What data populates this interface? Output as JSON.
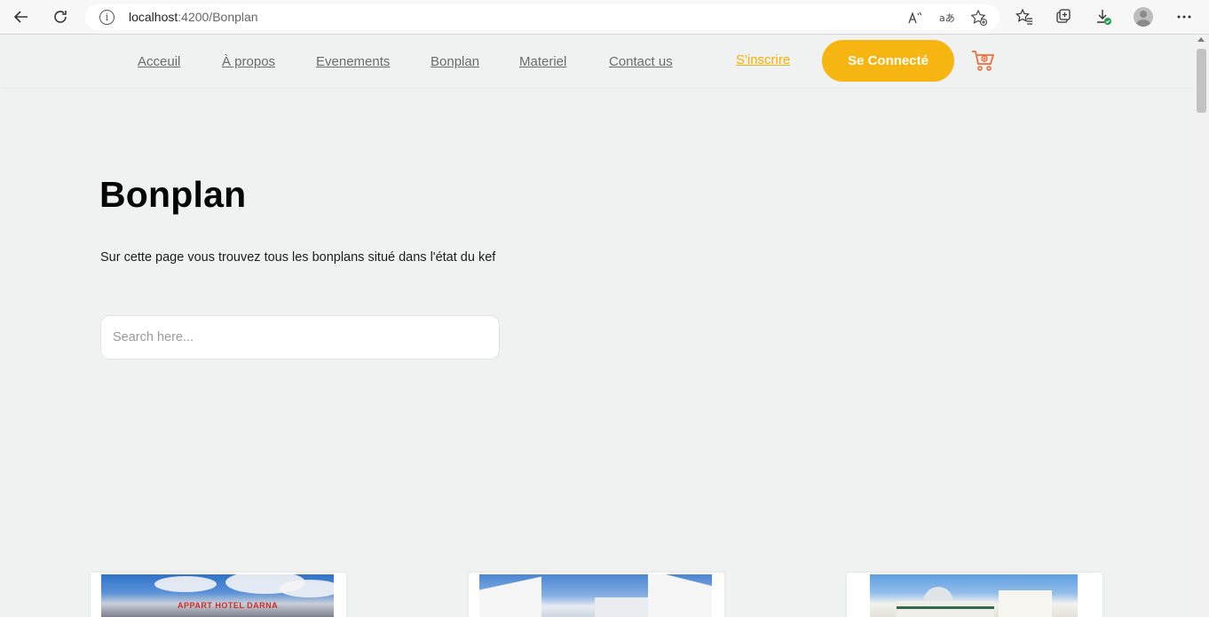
{
  "browser": {
    "url_host": "localhost",
    "url_path": ":4200/Bonplan",
    "back_icon": "back-arrow-icon",
    "refresh_icon": "refresh-icon",
    "info_icon": "info-icon"
  },
  "nav": {
    "links": [
      "Acceuil",
      "À propos",
      "Evenements",
      "Bonplan",
      "Materiel",
      "Contact us"
    ],
    "signup": "S'inscrire",
    "connect": "Se Connecté"
  },
  "hero": {
    "title": "Bonplan",
    "description": "Sur cette page vous trouvez tous les bonplans situé dans l'état du kef",
    "search_placeholder": "Search here..."
  },
  "cards": [
    {
      "sign_text": "APPART HOTEL DARNA"
    },
    {
      "sign_text": ""
    },
    {
      "sign_text": ""
    }
  ],
  "colors": {
    "accent": "#f7b512",
    "page_bg": "#f0f1f1",
    "cart": "#f26b3a"
  }
}
